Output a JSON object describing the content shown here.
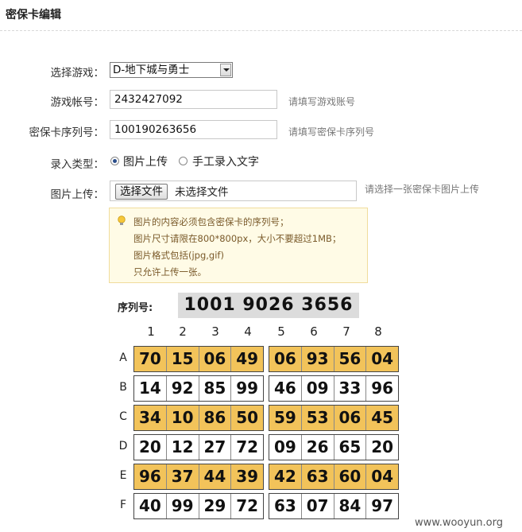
{
  "page_title": "密保卡编辑",
  "form": {
    "game_label": "选择游戏：",
    "game_value": "D-地下城与勇士",
    "account_label": "游戏帐号：",
    "account_value": "2432427092",
    "account_hint": "请填写游戏账号",
    "serial_label": "密保卡序列号：",
    "serial_value": "100190263656",
    "serial_hint": "请填写密保卡序列号",
    "type_label": "录入类型：",
    "type_option_image": "图片上传",
    "type_option_manual": "手工录入文字",
    "type_selected": "图片上传",
    "upload_label": "图片上传：",
    "upload_button": "选择文件",
    "upload_status": "未选择文件",
    "upload_hint": "请选择一张密保卡图片上传"
  },
  "tip": {
    "lines": [
      "图片的内容必须包含密保卡的序列号；",
      "图片尺寸请限在800*800px，大小不要超过1MB；",
      "图片格式包括(jpg,gif)",
      "只允许上传一张。"
    ],
    "icon": "lightbulb-icon"
  },
  "card": {
    "serial_label": "序列号:",
    "serial_number": "1001 9026 3656",
    "columns": [
      "1",
      "2",
      "3",
      "4",
      "5",
      "6",
      "7",
      "8"
    ],
    "rows": [
      {
        "letter": "A",
        "left": [
          "70",
          "15",
          "06",
          "49"
        ],
        "right": [
          "06",
          "93",
          "56",
          "04"
        ],
        "highlight": true
      },
      {
        "letter": "B",
        "left": [
          "14",
          "92",
          "85",
          "99"
        ],
        "right": [
          "46",
          "09",
          "33",
          "96"
        ],
        "highlight": false
      },
      {
        "letter": "C",
        "left": [
          "34",
          "10",
          "86",
          "50"
        ],
        "right": [
          "59",
          "53",
          "06",
          "45"
        ],
        "highlight": true
      },
      {
        "letter": "D",
        "left": [
          "20",
          "12",
          "27",
          "72"
        ],
        "right": [
          "09",
          "26",
          "65",
          "20"
        ],
        "highlight": false
      },
      {
        "letter": "E",
        "left": [
          "96",
          "37",
          "44",
          "39"
        ],
        "right": [
          "42",
          "63",
          "60",
          "04"
        ],
        "highlight": true
      },
      {
        "letter": "F",
        "left": [
          "40",
          "99",
          "29",
          "72"
        ],
        "right": [
          "63",
          "07",
          "84",
          "97"
        ],
        "highlight": false
      }
    ],
    "highlight_color": "#f2c35a"
  },
  "watermark": "www.wooyun.org"
}
